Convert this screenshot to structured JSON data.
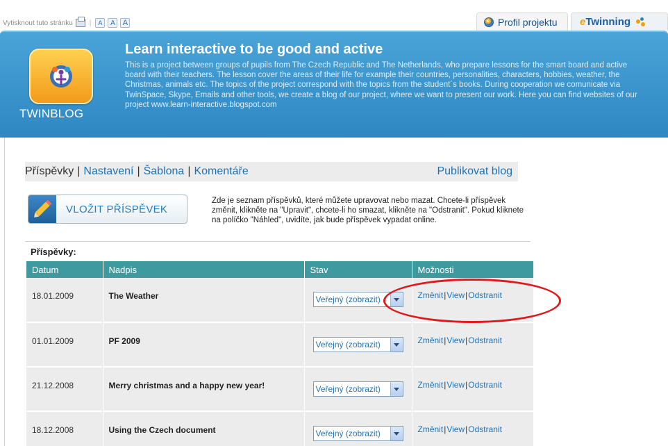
{
  "topbar": {
    "print_label": "Vytisknout tuto stránku",
    "font_sizes": [
      "A",
      "A",
      "A"
    ],
    "profile_tab": "Profil projektu",
    "etwinning_prefix": "e",
    "etwinning_suffix": "Twinning"
  },
  "banner": {
    "logo_text": "TWINBLOG",
    "title": "Learn interactive to be good and active",
    "description": "This is a project between groups of pupils from The Czech Republic and The Netherlands, who prepare lessons for the smart board and active board with their teachers. The lesson cover the areas of their life for example their countries, personalities, characters, hobbies, weather, the Christmas, animals etc. The topics of the project correspond with the topics from the student´s books. During cooperation we comunicate via TwinSpace, Skype, Emails and other tools, we create a blog of our project, where we want to present our work. Here you can find websites of our project www.learn-interactive.blogspot.com"
  },
  "nav": {
    "current": "Příspěvky",
    "links": [
      "Nastavení",
      "Šablona",
      "Komentáře"
    ],
    "publish": "Publikovat blog"
  },
  "new_post": {
    "label": "VLOŽIT PŘÍSPĚVEK"
  },
  "info_text": "Zde je seznam příspěvků, které můžete upravovat nebo mazat. Chcete-li příspěvek změnit, klikněte na \"Upravit\", chcete-li ho smazat, klikněte na \"Odstranit\". Pokud kliknete na políčko \"Náhled\", uvidíte, jak bude příspěvek vypadat online.",
  "posts": {
    "label": "Příspěvky:",
    "columns": [
      "Datum",
      "Nadpis",
      "Stav",
      "Možnosti"
    ],
    "rows": [
      {
        "date": "18.01.2009",
        "title": "The Weather",
        "status": "Veřejný (zobrazit)"
      },
      {
        "date": "01.01.2009",
        "title": "PF 2009",
        "status": "Veřejný (zobrazit)"
      },
      {
        "date": "21.12.2008",
        "title": "Merry christmas and a happy new year!",
        "status": "Veřejný (zobrazit)"
      },
      {
        "date": "18.12.2008",
        "title": "Using the Czech document",
        "status": "Veřejný (zobrazit)"
      }
    ],
    "options": {
      "edit": "Změnit",
      "view": "View",
      "delete": "Odstranit",
      "separator": "|"
    }
  },
  "colors": {
    "banner_blue": "#2e87c2",
    "table_header": "#3f9aa0",
    "link_blue": "#1e73b8",
    "annotation_red": "#e0191b"
  }
}
